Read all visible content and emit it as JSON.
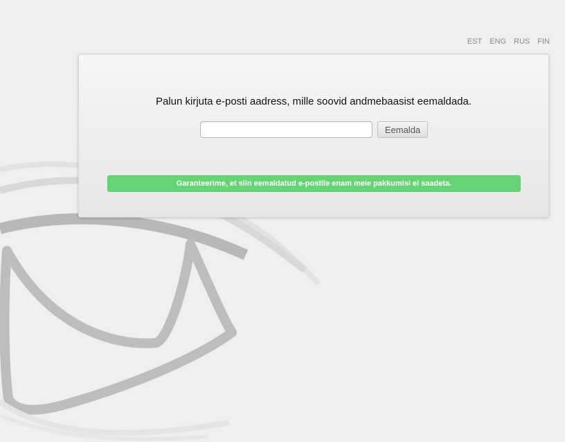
{
  "languages": [
    "EST",
    "ENG",
    "RUS",
    "FIN"
  ],
  "form": {
    "prompt": "Palun kirjuta e-posti aadress, mille soovid andmebaasist eemaldada.",
    "email_value": "",
    "email_placeholder": "",
    "button_label": "Eemalda"
  },
  "notice": "Garanteerime, et siin eemaldatud e-postile enam meie pakkumisi ei saadeta.",
  "colors": {
    "accent_green": "#66d474",
    "background": "#efefef"
  },
  "icons": {
    "background_graphic": "envelope-icon"
  }
}
